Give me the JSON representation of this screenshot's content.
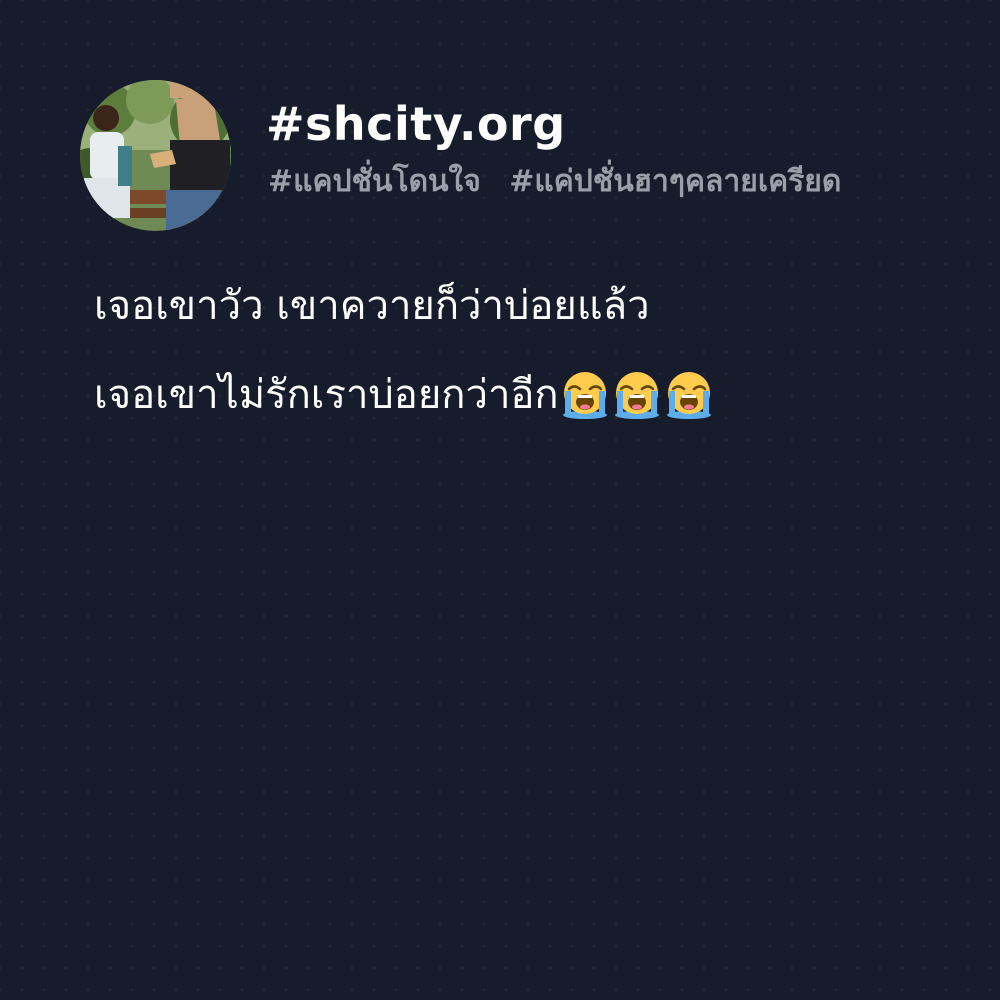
{
  "brand": "#shcity.org",
  "hashtags": [
    "#แคปชั่นโดนใจ",
    "#แค่ปชั่นฮาๆคลายเครียด"
  ],
  "caption_lines": [
    "เจอเขาวัว เขาควายก็ว่าบ่อยแล้ว",
    "เจอเขาไม่รักเราบ่อยกว่าอีก"
  ],
  "emoji": {
    "name": "loudly-crying-face-icon",
    "count": 3
  },
  "colors": {
    "background": "#161c2b",
    "text": "#ffffff",
    "tags": "#9aa0aa"
  }
}
